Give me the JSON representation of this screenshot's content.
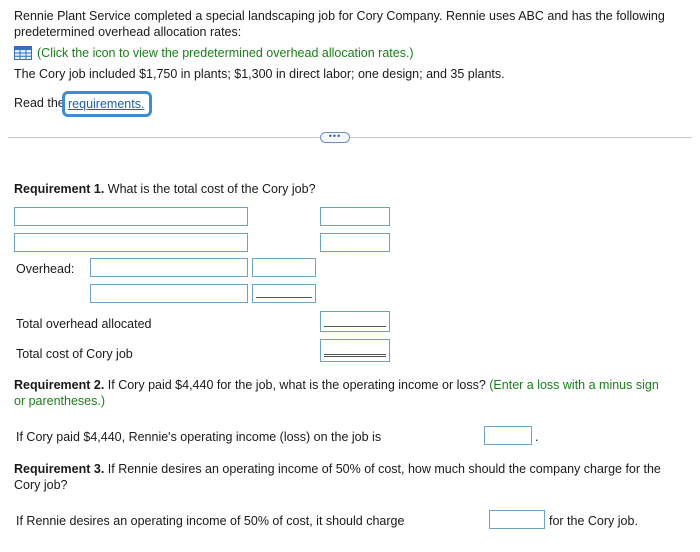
{
  "intro": {
    "line1": "Rennie Plant Service completed a special landscaping job for Cory Company. Rennie uses ABC and has the following",
    "line2": "predetermined overhead allocation rates:",
    "icon_link": "(Click the icon to view the predetermined overhead allocation rates.)",
    "line3": "The Cory job included $1,750 in plants; $1,300 in direct labor; one design; and 35 plants.",
    "read_prefix": "Read the",
    "requirements_link": "requirements."
  },
  "expand_button": "•••",
  "req1": {
    "title_bold": "Requirement 1.",
    "title_rest": " What is the total cost of the Cory job?",
    "overhead_label": "Overhead:",
    "total_overhead_label": "Total overhead allocated",
    "total_cost_label": "Total cost of Cory job"
  },
  "req2": {
    "title_bold": "Requirement 2.",
    "title_rest": " If Cory paid $4,440 for the job, what is the operating income or loss?",
    "hint_line1": "(Enter a loss with a minus sign",
    "hint_line2": "or parentheses.)",
    "question": "If Cory paid $4,440, Rennie's operating income (loss) on the job is",
    "suffix": "."
  },
  "req3": {
    "title_line1_bold": "Requirement 3.",
    "title_line1_rest": " If Rennie desires an operating income of 50% of cost, how much should the company charge for the",
    "title_line2": "Cory job?",
    "question": "If Rennie desires an operating income of 50% of cost, it should charge",
    "suffix": "for the Cory job."
  },
  "colors": {
    "link_blue": "#1f5fa8",
    "hint_green": "#1a7f1a",
    "input_border": "#6aa5c8",
    "focus_blue": "#3f8bd8"
  }
}
